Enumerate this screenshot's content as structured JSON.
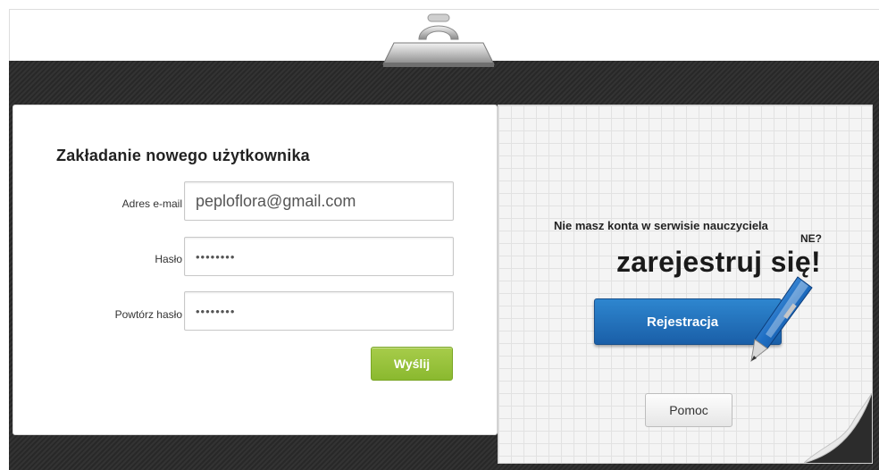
{
  "form": {
    "title": "Zakładanie nowego użytkownika",
    "email_label": "Adres e-mail",
    "email_value": "peploflora@gmail.com",
    "password_label": "Hasło",
    "password_value": "••••••••",
    "password_repeat_label": "Powtórz hasło",
    "password_repeat_value": "••••••••",
    "submit_label": "Wyślij"
  },
  "register": {
    "prompt": "Nie masz konta w serwisie nauczyciela",
    "prompt_suffix": "NE?",
    "headline": "zarejestruj się!",
    "register_button_label": "Rejestracja",
    "help_button_label": "Pomoc"
  },
  "icons": {
    "clip": "clipboard-clip-icon",
    "pen": "pen-icon",
    "curl": "page-curl-icon"
  },
  "colors": {
    "submit_green": "#8ab92f",
    "register_blue": "#1a5fa8",
    "board_dark": "#2c2c2c"
  }
}
